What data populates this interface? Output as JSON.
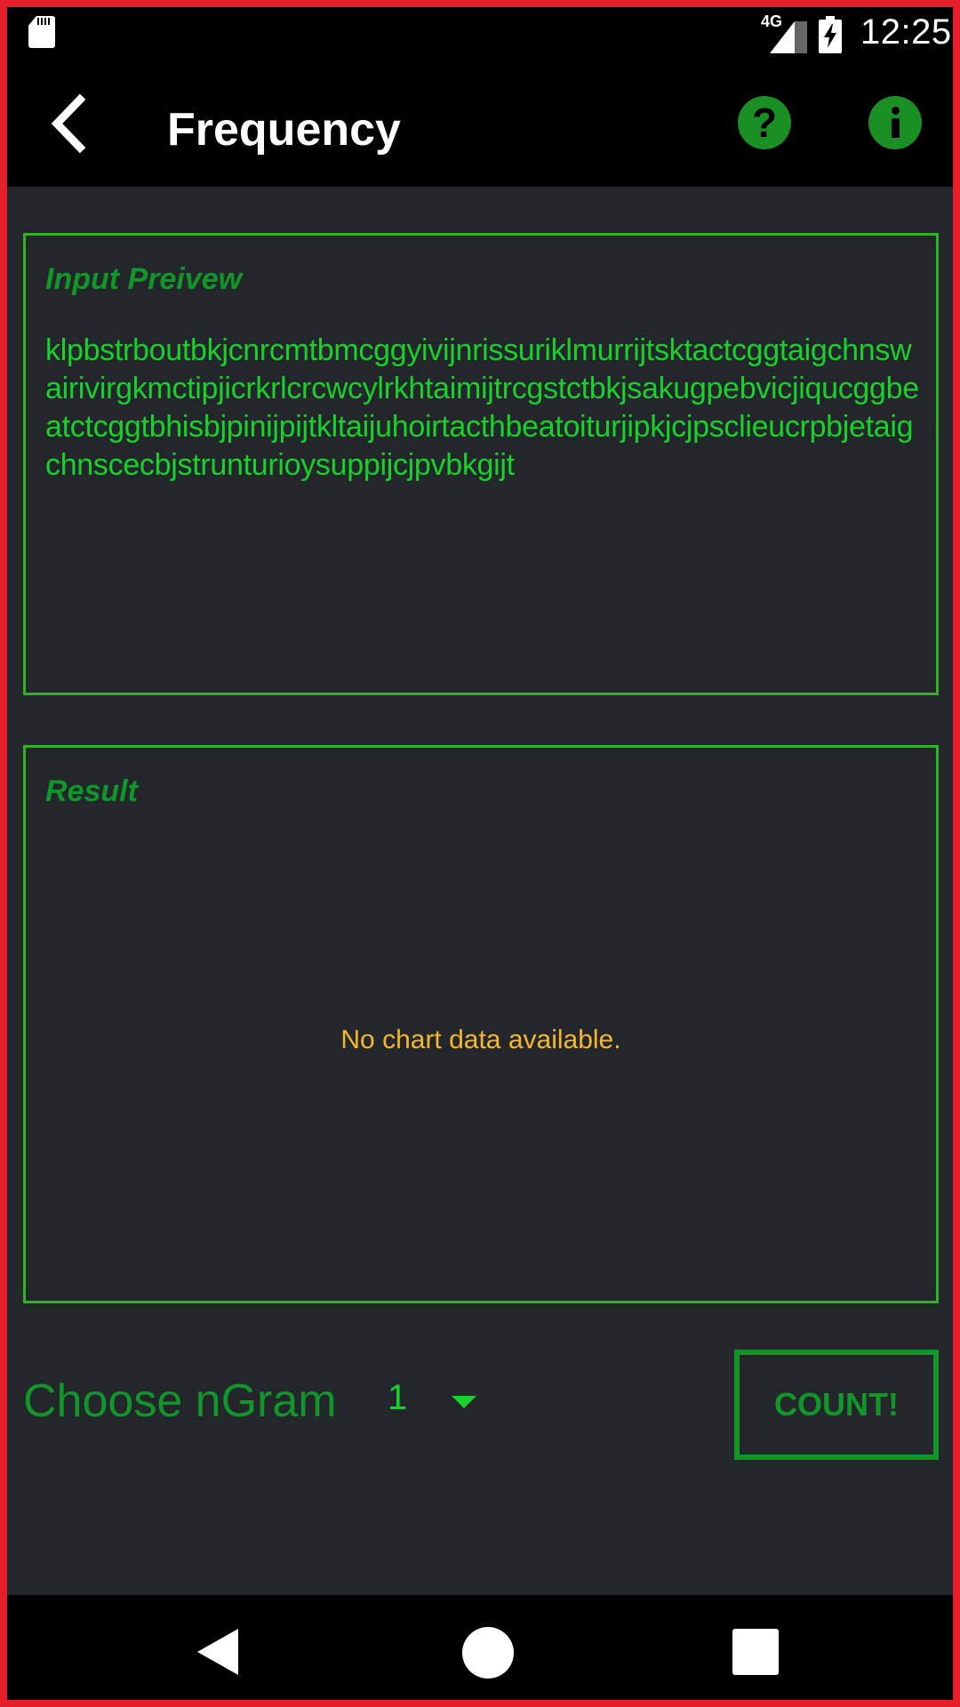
{
  "status_bar": {
    "time": "12:25",
    "network": "4G",
    "icons": [
      "sd-card-icon",
      "signal-icon",
      "battery-charging-icon"
    ]
  },
  "app_bar": {
    "title": "Frequency",
    "icons": [
      "back-arrow-icon",
      "help-icon",
      "info-icon"
    ],
    "help_glyph": "?"
  },
  "input_panel": {
    "title": "Input Preivew",
    "text": "klpbstrboutbkjcnrcmtbmcggyivijnrissuriklmurrijtsktactcggtaigchnswairivirgkmctipjicrkrlcrcwcylrkhtaimijtrcgstctbkjsakugpebvicjiqucggbeatctcggtbhisbjpinijpijtkltaijuhoirtacthbeatoiturjipkjcjpsclieucrpbjetaigchnscecbjstrunturioysuppijcjpvbkgijt"
  },
  "result_panel": {
    "title": "Result",
    "empty_message": "No chart data available."
  },
  "controls": {
    "ngram_label": "Choose nGram",
    "ngram_value": "1",
    "count_button": "COUNT!"
  },
  "nav_bar": {
    "icons": [
      "nav-back-icon",
      "nav-home-icon",
      "nav-recents-icon"
    ]
  },
  "colors": {
    "accent_green": "#12962a",
    "text_green": "#19d12b",
    "border_green": "#2fb423",
    "warning_yellow": "#f4b82f",
    "background": "#23262b",
    "frame_red": "#e3202a"
  }
}
